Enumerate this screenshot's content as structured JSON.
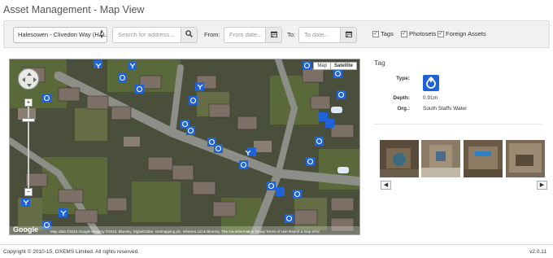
{
  "page": {
    "title": "Asset Management - Map View"
  },
  "filters": {
    "location": "Halesowen - Clivedon Way (HAL",
    "search_placeholder": "Search for address...",
    "from_label": "From:",
    "from_placeholder": "From date...",
    "to_label": "To:",
    "to_placeholder": "To date...",
    "checkboxes": [
      {
        "label": "Tags",
        "checked": true
      },
      {
        "label": "Photosets",
        "checked": true
      },
      {
        "label": "Foreign Assets",
        "checked": true
      }
    ]
  },
  "map": {
    "map_btn": "Map",
    "satellite_btn": "Satellite",
    "active_type": "Satellite",
    "google_logo": "Google",
    "attribution": "Map data ©2015 Google Imagery ©2015, Bluesky, DigitalGlobe, Getmapping plc, Infoterra Ltd & Bluesky, The GeoInformation Group   Terms of Use   Report a map error",
    "zoom_level_fraction": 0.85,
    "pin_color": "#1f63d6"
  },
  "tag_panel": {
    "title": "Tag",
    "type_label": "Type:",
    "type_icon": "valve-tag-icon",
    "depth_label": "Depth:",
    "depth_value": "0.91m",
    "org_label": "Org.:",
    "org_value": "South Staffs Water",
    "prev_label": "◀",
    "next_label": "▶"
  },
  "footer": {
    "copyright": "Copyright © 2010-15, OXEMS Limited. All rights reserved.",
    "version": "v2.0.11"
  }
}
